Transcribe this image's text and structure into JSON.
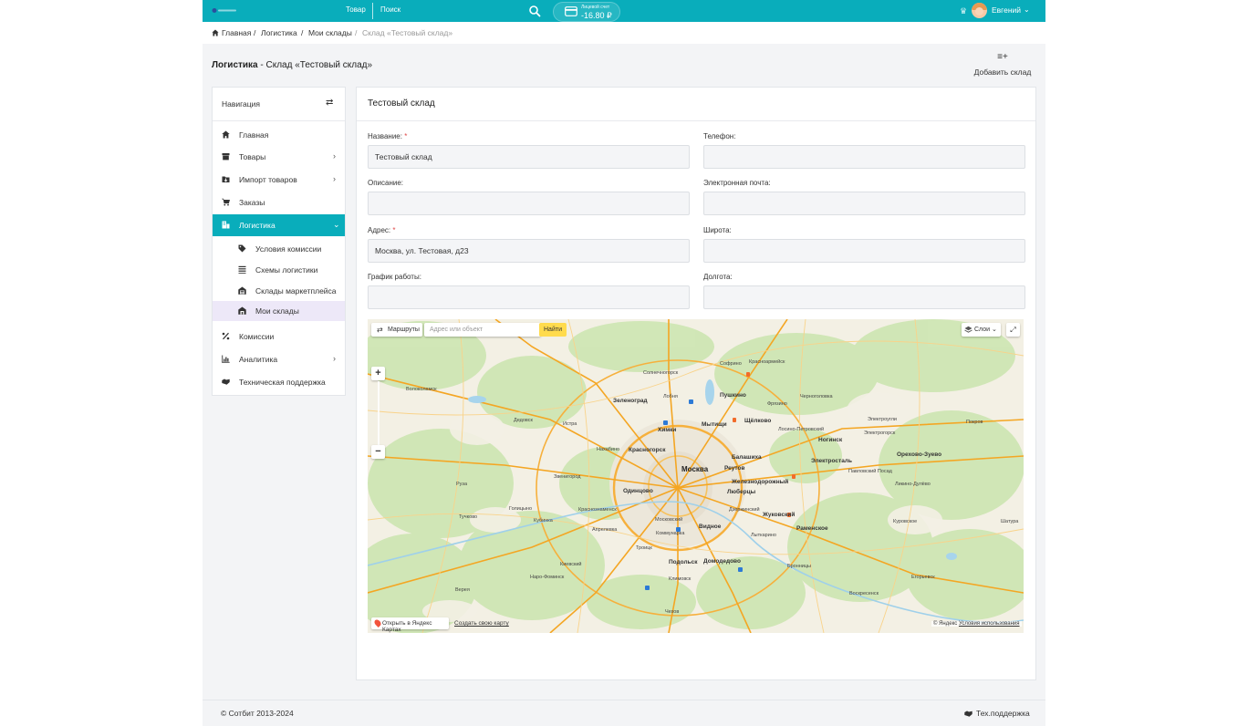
{
  "topbar": {
    "product_link": "Товар",
    "search_link": "Поиск",
    "balance_label": "Лицевой счет",
    "balance_value": "-16.80 ₽",
    "user_name": "Евгений",
    "accent_color": "#09adbb"
  },
  "breadcrumb": {
    "items": [
      "Главная",
      "Логистика",
      "Мои склады"
    ],
    "current": "Склад «Тестовый склад»"
  },
  "page": {
    "title_bold": "Логистика",
    "title_rest": " - Склад «Тестовый склад»",
    "add_button": "Добавить склад"
  },
  "nav": {
    "header": "Навигация",
    "items": [
      {
        "label": "Главная",
        "icon": "home-icon"
      },
      {
        "label": "Товары",
        "icon": "box-icon"
      },
      {
        "label": "Импорт товаров",
        "icon": "folder-import-icon"
      },
      {
        "label": "Заказы",
        "icon": "cart-icon"
      },
      {
        "label": "Логистика",
        "icon": "building-icon"
      },
      {
        "label": "Комиссии",
        "icon": "percent-icon"
      },
      {
        "label": "Аналитика",
        "icon": "chart-icon"
      },
      {
        "label": "Техническая поддержка",
        "icon": "handshake-icon"
      }
    ],
    "subitems": [
      {
        "label": "Условия комиссии",
        "icon": "tag-icon"
      },
      {
        "label": "Схемы логистики",
        "icon": "list-icon"
      },
      {
        "label": "Склады маркетплейса",
        "icon": "warehouse-icon"
      },
      {
        "label": "Мои склады",
        "icon": "my-warehouse-icon"
      }
    ]
  },
  "form": {
    "title": "Тестовый склад",
    "required_mark": "*",
    "name_label": "Название:",
    "name_value": "Тестовый склад",
    "phone_label": "Телефон:",
    "phone_value": "",
    "description_label": "Описание:",
    "description_value": "",
    "email_label": "Электронная почта:",
    "email_value": "",
    "address_label": "Адрес:",
    "address_value": "Москва, ул. Тестовая, д23",
    "latitude_label": "Широта:",
    "latitude_value": "",
    "schedule_label": "График работы:",
    "schedule_value": "",
    "longitude_label": "Долгота:",
    "longitude_value": ""
  },
  "map": {
    "routes_button": "Маршруты",
    "search_placeholder": "Адрес или объект",
    "find_button": "Найти",
    "layers_button": "Слои",
    "open_yandex": "Открыть в Яндекс Картах",
    "create_map": "Создать свою карту",
    "copyright": "© Яндекс",
    "terms": "Условия использования",
    "cities": {
      "moscow": "Москва",
      "zelenograd": "Зеленоград",
      "khimki": "Химки",
      "mytishchi": "Мытищи",
      "krasnogorsk": "Красногорск",
      "balashikha": "Балашиха",
      "lyubertsy": "Люберцы",
      "odintsovo": "Одинцово",
      "podolsk": "Подольск",
      "pushkino": "Пушкино",
      "shchyolkovo": "Щёлково",
      "korolev": "Королёв",
      "noginsk": "Ногинск",
      "elektrostal": "Электросталь",
      "orekhovo": "Орехово-Зуево",
      "domodedovo": "Домодедово",
      "vidnoye": "Видное",
      "zhukovsky": "Жуковский",
      "ramenskoye": "Раменское",
      "reutov": "Реутов",
      "zheleznodorozhny": "Железнодорожный",
      "istra": "Истра",
      "lobnya": "Лобня",
      "dolgoprudny": "Долгопрудный",
      "dedovsk": "Дедовск",
      "nakhabino": "Нахабино",
      "troitsk": "Троицк",
      "klimovsk": "Климовск",
      "krasnoarmeysk": "Красноармейск",
      "fryazino": "Фрязино",
      "chernogolovka": "Черноголовка",
      "pavlovsky_posad": "Павловский Посад",
      "voskresensk": "Воскресенск",
      "bronnitsy": "Бронницы",
      "kubinka": "Кубинка",
      "aprelevka": "Апрелевка",
      "zvenigorod": "Звенигород",
      "volokolamsk": "Волоколамск",
      "ruza": "Руза",
      "naro_fominsk": "Наро-Фоминск",
      "chekhov": "Чехов",
      "solnechnogorsk": "Солнечногорск",
      "dzerzhinsky": "Дзержинский",
      "elektrougli": "Электроугли",
      "losino": "Лосино-Петровский",
      "sofrino": "Софрино",
      "kurovskoye": "Куровское",
      "shatura": "Шатура",
      "egoryevsk": "Егорьевск",
      "likino": "Ликино-Дулёво",
      "krasnoznamensk": "Краснознаменск",
      "golitsyno": "Голицыно",
      "tuchkovo": "Тучково",
      "kievsky": "Киевский",
      "lytkarino": "Лыткарино",
      "pokrov": "Покров",
      "vereya": "Верея",
      "elektrogorsk": "Электрогорск",
      "kommunarka": "Коммунарка",
      "moskovsky": "Московский"
    }
  },
  "footer": {
    "copyright": "© Сотбит 2013-2024",
    "support": "Тех.поддержка"
  }
}
